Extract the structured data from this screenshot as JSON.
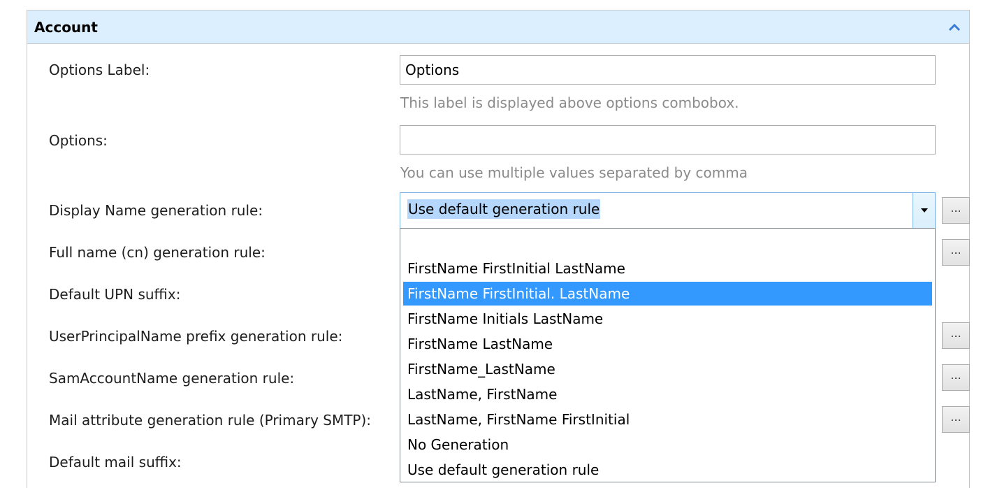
{
  "section": {
    "title": "Account",
    "collapse_icon": "chevron-up-icon"
  },
  "fields": {
    "options_label": {
      "label": "Options Label:",
      "value": "Options",
      "hint": "This label is displayed above options combobox."
    },
    "options": {
      "label": "Options:",
      "value": "",
      "hint": "You can use multiple values separated by comma"
    },
    "display_name_rule": {
      "label": "Display Name generation rule:",
      "value": "Use default generation rule"
    },
    "full_name_rule": {
      "label": "Full name (cn) generation rule:"
    },
    "default_upn_suffix": {
      "label": "Default UPN suffix:"
    },
    "upn_prefix_rule": {
      "label": "UserPrincipalName prefix generation rule:"
    },
    "sam_rule": {
      "label": "SamAccountName generation rule:"
    },
    "mail_rule": {
      "label": "Mail attribute generation rule (Primary SMTP):"
    },
    "default_mail_suffix": {
      "label": "Default mail suffix:"
    }
  },
  "dropdown": {
    "options": [
      "",
      "FirstName FirstInitial LastName",
      "FirstName FirstInitial. LastName",
      "FirstName Initials LastName",
      "FirstName LastName",
      "FirstName_LastName",
      "LastName, FirstName",
      "LastName, FirstName FirstInitial",
      "No Generation",
      "Use default generation rule"
    ],
    "highlighted_index": 2
  },
  "buttons": {
    "ellipsis_label": "..."
  },
  "colors": {
    "header_bg": "#dcefff",
    "highlight": "#3399ff",
    "text_selection": "#b5d7fb",
    "hint_text": "#8a8a8a"
  }
}
